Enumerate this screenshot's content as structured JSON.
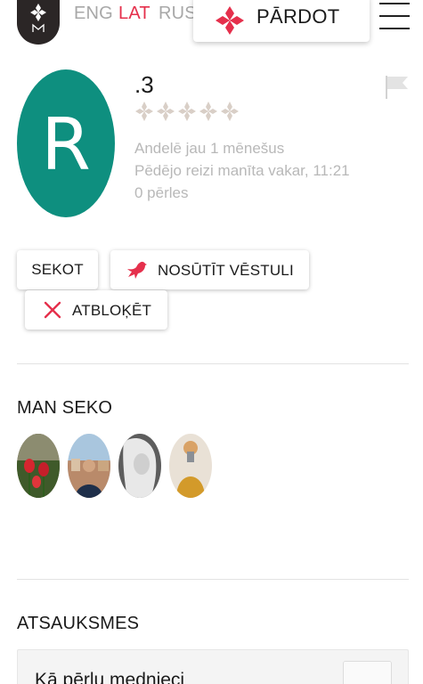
{
  "header": {
    "languages": [
      {
        "code": "ENG",
        "active": false
      },
      {
        "code": "LAT",
        "active": true
      },
      {
        "code": "RUS",
        "active": false
      }
    ],
    "sell_label": "PĀRDOT",
    "sell_icon": "diamond-cross-icon",
    "menu_icon": "hamburger-icon",
    "accent_color": "#e5304c"
  },
  "profile": {
    "avatar_initial": "R",
    "avatar_color": "#0e8f7f",
    "username": ".3",
    "rating": {
      "filled": 0,
      "max": 5
    },
    "trading_since": "Andelē jau 1 mēnešus",
    "last_seen": "Pēdējo reizi manīta vakar, 11:21",
    "pearls": "0 pērles"
  },
  "actions": {
    "follow_label": "SEKOT",
    "message_label": "NOSŪTĪT VĒSTULI",
    "message_icon": "bird-icon",
    "block_label": "ATBLOĶĒT",
    "block_icon": "close-icon"
  },
  "followers": {
    "title": "MAN SEKO",
    "items": [
      {
        "name": "follower-1"
      },
      {
        "name": "follower-2"
      },
      {
        "name": "follower-3"
      },
      {
        "name": "follower-4"
      }
    ]
  },
  "reviews": {
    "title": "ATSAUKSMES",
    "first_review_text": "Kā pērļu mednieci"
  }
}
